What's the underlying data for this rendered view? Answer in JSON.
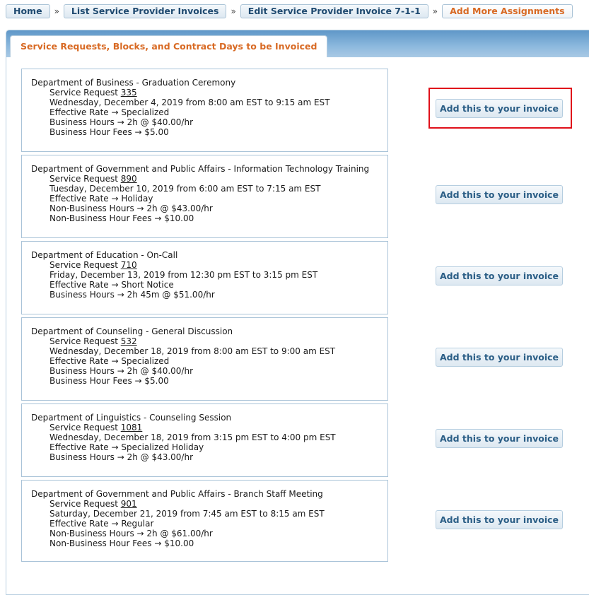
{
  "breadcrumb": {
    "items": [
      {
        "label": "Home"
      },
      {
        "label": "List Service Provider Invoices"
      },
      {
        "label": "Edit Service Provider Invoice 7-1-1"
      },
      {
        "label": "Add More Assignments"
      }
    ],
    "separator": "»"
  },
  "tab": {
    "label": "Service Requests, Blocks, and Contract Days to be Invoiced"
  },
  "add_button_label": "Add this to your invoice",
  "requests": [
    {
      "department": "Department of Business - Graduation Ceremony",
      "sr_prefix": "Service Request ",
      "sr_number": "335",
      "lines": [
        "Wednesday, December 4, 2019 from 8:00 am EST to 9:15 am EST",
        "Effective Rate → Specialized",
        "Business Hours → 2h @ $40.00/hr",
        "Business Hour Fees → $5.00"
      ]
    },
    {
      "department": "Department of Government and Public Affairs - Information Technology Training",
      "sr_prefix": "Service Request ",
      "sr_number": "890",
      "lines": [
        "Tuesday, December 10, 2019 from 6:00 am EST to 7:15 am EST",
        "Effective Rate → Holiday",
        "Non-Business Hours → 2h @ $43.00/hr",
        "Non-Business Hour Fees → $10.00"
      ]
    },
    {
      "department": "Department of Education - On-Call",
      "sr_prefix": "Service Request ",
      "sr_number": "710",
      "lines": [
        "Friday, December 13, 2019 from 12:30 pm EST to 3:15 pm EST",
        "Effective Rate → Short Notice",
        "Business Hours → 2h 45m @ $51.00/hr"
      ]
    },
    {
      "department": "Department of Counseling - General Discussion",
      "sr_prefix": "Service Request ",
      "sr_number": "532",
      "lines": [
        "Wednesday, December 18, 2019 from 8:00 am EST to 9:00 am EST",
        "Effective Rate → Specialized",
        "Business Hours → 2h @ $40.00/hr",
        "Business Hour Fees → $5.00"
      ]
    },
    {
      "department": "Department of Linguistics - Counseling Session",
      "sr_prefix": "Service Request ",
      "sr_number": "1081",
      "lines": [
        "Wednesday, December 18, 2019 from 3:15 pm EST to 4:00 pm EST",
        "Effective Rate → Specialized Holiday",
        "Business Hours → 2h @ $43.00/hr"
      ]
    },
    {
      "department": "Department of Government and Public Affairs - Branch Staff Meeting",
      "sr_prefix": "Service Request ",
      "sr_number": "901",
      "lines": [
        "Saturday, December 21, 2019 from 7:45 am EST to 8:15 am EST",
        "Effective Rate → Regular",
        "Non-Business Hours → 2h @ $61.00/hr",
        "Non-Business Hour Fees → $10.00"
      ]
    }
  ],
  "colors": {
    "accent_orange": "#d86a24",
    "link_blue": "#2b5e86",
    "highlight_red": "#e0101a",
    "tab_bar_blue": "#8db9de"
  }
}
